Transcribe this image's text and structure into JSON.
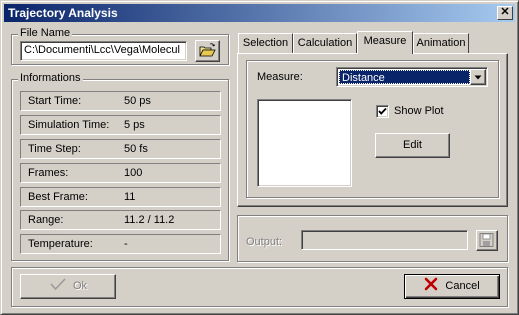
{
  "window": {
    "title": "Trajectory Analysis",
    "close_glyph": "✕"
  },
  "file": {
    "group_label": "File Name",
    "path": "C:\\Documenti\\Lcc\\Vega\\Molecul"
  },
  "informations": {
    "group_label": "Informations",
    "rows": [
      {
        "label": "Start Time:",
        "value": "50 ps"
      },
      {
        "label": "Simulation Time:",
        "value": "5 ps"
      },
      {
        "label": "Time Step:",
        "value": "50 fs"
      },
      {
        "label": "Frames:",
        "value": "100"
      },
      {
        "label": "Best Frame:",
        "value": "11"
      },
      {
        "label": "Range:",
        "value": "11.2 / 11.2"
      },
      {
        "label": "Temperature:",
        "value": "-"
      }
    ]
  },
  "tabs": [
    {
      "label": "Selection"
    },
    {
      "label": "Calculation"
    },
    {
      "label": "Measure",
      "active": true
    },
    {
      "label": "Animation"
    }
  ],
  "measure": {
    "label": "Measure:",
    "selected": "Distance",
    "show_plot_label": "Show Plot",
    "show_plot_checked": true,
    "edit_label": "Edit"
  },
  "output": {
    "label": "Output:",
    "value": ""
  },
  "buttons": {
    "ok_label": "Ok",
    "cancel_label": "Cancel"
  },
  "colors": {
    "title_start": "#0a246a",
    "title_end": "#a6caf0",
    "selection": "#0a246a",
    "cancel_x": "#c00000"
  }
}
